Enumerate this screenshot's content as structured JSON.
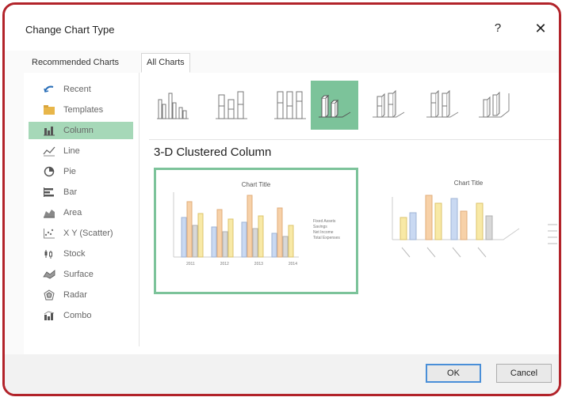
{
  "dialog": {
    "title": "Change Chart Type",
    "help_glyph": "?",
    "close_glyph": "✕"
  },
  "tabs": [
    {
      "label": "Recommended Charts",
      "active": false
    },
    {
      "label": "All Charts",
      "active": true
    }
  ],
  "sidebar": {
    "selected": "Column",
    "items": [
      {
        "label": "Recent",
        "icon": "recent-icon"
      },
      {
        "label": "Templates",
        "icon": "folder-icon"
      },
      {
        "label": "Column",
        "icon": "column-chart-icon"
      },
      {
        "label": "Line",
        "icon": "line-chart-icon"
      },
      {
        "label": "Pie",
        "icon": "pie-chart-icon"
      },
      {
        "label": "Bar",
        "icon": "bar-chart-icon"
      },
      {
        "label": "Area",
        "icon": "area-chart-icon"
      },
      {
        "label": "X Y (Scatter)",
        "icon": "scatter-chart-icon"
      },
      {
        "label": "Stock",
        "icon": "stock-chart-icon"
      },
      {
        "label": "Surface",
        "icon": "surface-chart-icon"
      },
      {
        "label": "Radar",
        "icon": "radar-chart-icon"
      },
      {
        "label": "Combo",
        "icon": "combo-chart-icon"
      }
    ]
  },
  "subtypes": {
    "count": 7,
    "selected_index": 3
  },
  "selected_subtype_name": "3-D Clustered Column",
  "previews": [
    {
      "title": "Chart Title",
      "legend": [
        "Fixed Assets",
        "Savings",
        "Net Income",
        "Total Expenses"
      ],
      "categories": [
        "2011",
        "2012",
        "2013",
        "2014"
      ]
    },
    {
      "title": "Chart Title",
      "legend": [
        "",
        "",
        "",
        ""
      ]
    }
  ],
  "footer": {
    "ok_label": "OK",
    "cancel_label": "Cancel"
  },
  "colors": {
    "accent": "#7cc39a",
    "sidebar_selected": "#a6d8b8",
    "frame_border": "#b2232a",
    "ok_border": "#4a8fd8",
    "series": [
      "#c9d9f2",
      "#f7d1a8",
      "#d8d8d8",
      "#f8e9a6"
    ]
  }
}
